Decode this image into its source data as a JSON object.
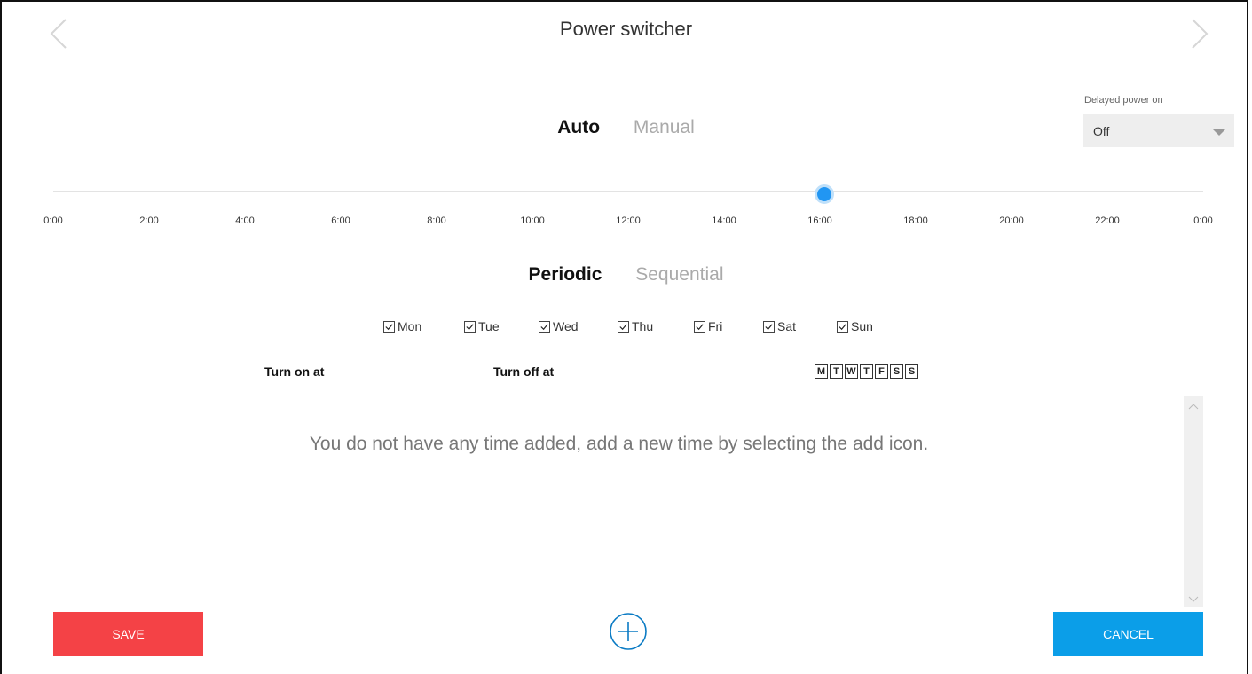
{
  "header": {
    "title": "Power switcher",
    "prev_icon": "chevron-left-icon",
    "next_icon": "chevron-right-icon"
  },
  "delayed_power": {
    "label": "Delayed power on",
    "selected": "Off"
  },
  "mode_tabs": {
    "active": "Auto",
    "inactive": "Manual"
  },
  "timeline": {
    "ticks": [
      "0:00",
      "2:00",
      "4:00",
      "6:00",
      "8:00",
      "10:00",
      "12:00",
      "14:00",
      "16:00",
      "18:00",
      "20:00",
      "22:00",
      "0:00"
    ],
    "current_hour": 16.1,
    "accent": "#2196f3"
  },
  "schedule_tabs": {
    "active": "Periodic",
    "inactive": "Sequential"
  },
  "days": [
    {
      "label": "Mon",
      "checked": true
    },
    {
      "label": "Tue",
      "checked": true
    },
    {
      "label": "Wed",
      "checked": true
    },
    {
      "label": "Thu",
      "checked": true
    },
    {
      "label": "Fri",
      "checked": true
    },
    {
      "label": "Sat",
      "checked": true
    },
    {
      "label": "Sun",
      "checked": true
    }
  ],
  "columns": {
    "turn_on": "Turn on at",
    "turn_off": "Turn off at",
    "week_letters": [
      "M",
      "T",
      "W",
      "T",
      "F",
      "S",
      "S"
    ]
  },
  "list": {
    "empty_message": "You do not have any time added, add a new time by selecting the add icon."
  },
  "actions": {
    "save": "SAVE",
    "cancel": "CANCEL",
    "add_icon": "plus-circle-icon",
    "save_color": "#f44246",
    "cancel_color": "#0b9ee8"
  }
}
